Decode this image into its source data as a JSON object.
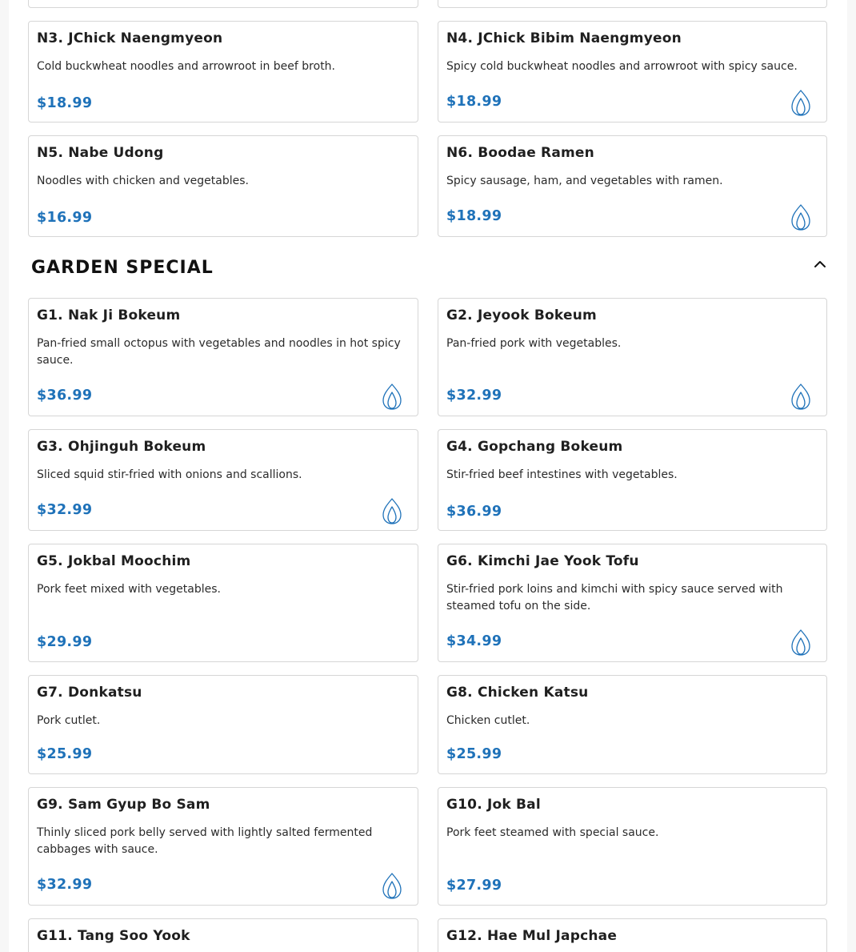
{
  "section": {
    "title": "GARDEN SPECIAL"
  },
  "items": [
    {
      "title": "N3. JChick Naengmyeon",
      "description": "Cold buckwheat noodles and arrowroot in beef broth.",
      "price": "$18.99",
      "spicy": false
    },
    {
      "title": "N4. JChick Bibim Naengmyeon",
      "description": "Spicy cold buckwheat noodles and arrowroot with spicy sauce.",
      "price": "$18.99",
      "spicy": true
    },
    {
      "title": "N5. Nabe Udong",
      "description": "Noodles with chicken and vegetables.",
      "price": "$16.99",
      "spicy": false
    },
    {
      "title": "N6. Boodae Ramen",
      "description": "Spicy sausage, ham, and vegetables with ramen.",
      "price": "$18.99",
      "spicy": true
    },
    {
      "title": "G1. Nak Ji Bokeum",
      "description": "Pan-fried small octopus with vegetables and noodles in hot spicy sauce.",
      "price": "$36.99",
      "spicy": true
    },
    {
      "title": "G2. Jeyook Bokeum",
      "description": "Pan-fried pork with vegetables.",
      "price": "$32.99",
      "spicy": true
    },
    {
      "title": "G3. Ohjinguh Bokeum",
      "description": "Sliced squid stir-fried with onions and scallions.",
      "price": "$32.99",
      "spicy": true
    },
    {
      "title": "G4. Gopchang Bokeum",
      "description": "Stir-fried beef intestines with vegetables.",
      "price": "$36.99",
      "spicy": false
    },
    {
      "title": "G5. Jokbal Moochim",
      "description": "Pork feet mixed with vegetables.",
      "price": "$29.99",
      "spicy": false
    },
    {
      "title": "G6. Kimchi Jae Yook Tofu",
      "description": "Stir-fried pork loins and kimchi with spicy sauce served with steamed tofu on the side.",
      "price": "$34.99",
      "spicy": true
    },
    {
      "title": "G7. Donkatsu",
      "description": "Pork cutlet.",
      "price": "$25.99",
      "spicy": false
    },
    {
      "title": "G8. Chicken Katsu",
      "description": "Chicken cutlet.",
      "price": "$25.99",
      "spicy": false
    },
    {
      "title": "G9. Sam Gyup Bo Sam",
      "description": "Thinly sliced pork belly served with lightly salted fermented cabbages with sauce.",
      "price": "$32.99",
      "spicy": true
    },
    {
      "title": "G10. Jok Bal",
      "description": "Pork feet steamed with special sauce.",
      "price": "$27.99",
      "spicy": false
    },
    {
      "title": "G11. Tang Soo Yook",
      "description": "",
      "price": "",
      "spicy": false
    },
    {
      "title": "G12. Hae Mul Japchae",
      "description": "",
      "price": "",
      "spicy": false
    }
  ],
  "colors": {
    "price": "#1f72b9",
    "spicy_icon": "#1f72b9",
    "border": "#d6d6d6"
  },
  "icons": {
    "spicy": "flame-icon",
    "collapse": "chevron-up-icon"
  }
}
